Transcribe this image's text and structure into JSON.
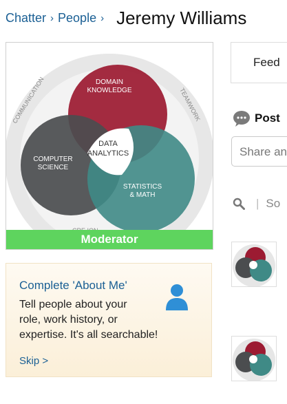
{
  "breadcrumb": {
    "chatter": "Chatter",
    "people": "People"
  },
  "page_title": "Jeremy Williams",
  "profile": {
    "venn": {
      "domain": [
        "DOMAIN",
        "KNOWLEDGE"
      ],
      "cs": [
        "COMPUTER",
        "SCIENCE"
      ],
      "stats": [
        "STATISTICS",
        "& MATH"
      ],
      "center": [
        "DATA",
        "ANALYTICS"
      ],
      "communication": "COMMUNICATION",
      "teamwork": "TEAMWORK",
      "bottom_partial": "CRE          ION"
    },
    "badge": "Moderator"
  },
  "about": {
    "title": "Complete 'About Me'",
    "lines": [
      "Tell people about your",
      "role, work history, or",
      "expertise. It's all searchable!"
    ],
    "skip": "Skip >"
  },
  "feed": {
    "tab_label": "Feed"
  },
  "post": {
    "label": "Post"
  },
  "share": {
    "placeholder": "Share an"
  },
  "search": {
    "placeholder": "So"
  },
  "colors": {
    "link": "#1a5f94",
    "moderator": "#5ed45e",
    "domain": "#9c1b32",
    "cs": "#4b4d4f",
    "stats": "#3f8a86"
  }
}
